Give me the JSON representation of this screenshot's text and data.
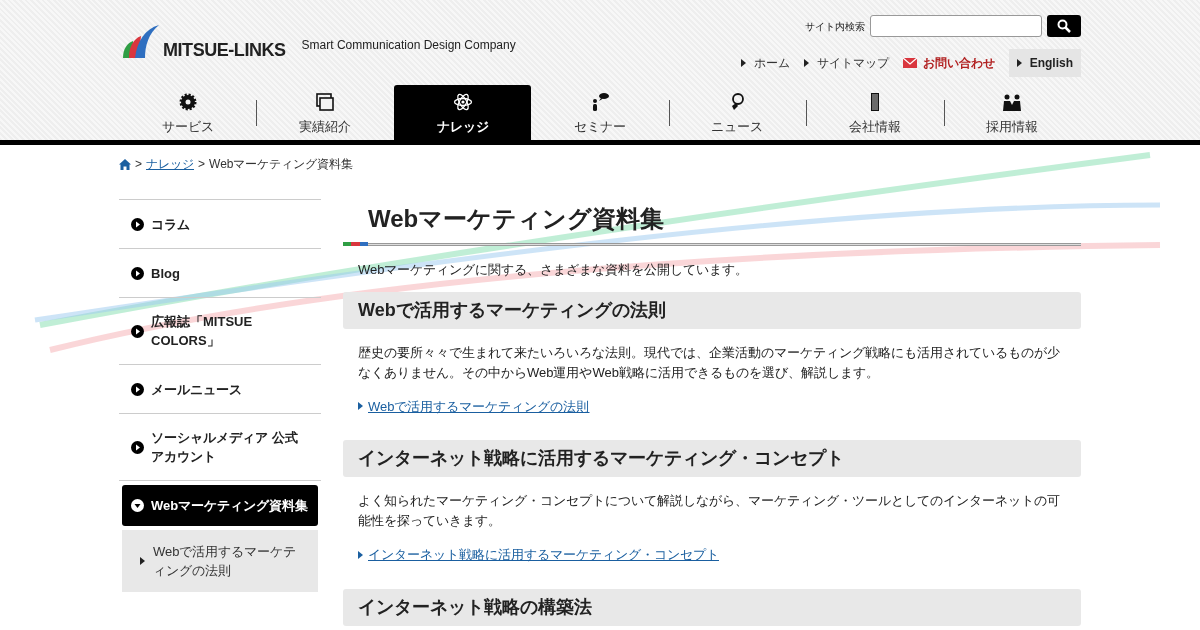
{
  "logo": {
    "text": "MITSUE-LINKS",
    "tagline": "Smart Communication Design Company"
  },
  "search": {
    "label": "サイト内検索"
  },
  "utility_links": [
    {
      "kind": "plain",
      "label": "ホーム"
    },
    {
      "kind": "plain",
      "label": "サイトマップ"
    },
    {
      "kind": "mail",
      "label": "お問い合わせ"
    },
    {
      "kind": "boxed",
      "label": "English"
    }
  ],
  "nav": [
    {
      "label": "サービス",
      "selected": false
    },
    {
      "label": "実績紹介",
      "selected": false
    },
    {
      "label": "ナレッジ",
      "selected": true
    },
    {
      "label": "セミナー",
      "selected": false
    },
    {
      "label": "ニュース",
      "selected": false
    },
    {
      "label": "会社情報",
      "selected": false
    },
    {
      "label": "採用情報",
      "selected": false
    }
  ],
  "breadcrumb": [
    {
      "separator": ">",
      "label": "ナレッジ",
      "link": true
    },
    {
      "separator": ">",
      "label": "Webマーケティング資料集",
      "link": false
    }
  ],
  "sidebar": [
    {
      "kind": "main",
      "label": "コラム"
    },
    {
      "kind": "main",
      "label": "Blog"
    },
    {
      "kind": "main",
      "label": "広報誌「MITSUE COLORS」"
    },
    {
      "kind": "main",
      "label": "メールニュース"
    },
    {
      "kind": "main",
      "label": "ソーシャルメディア 公式アカウント"
    },
    {
      "kind": "active",
      "label": "Webマーケティング資料集"
    },
    {
      "kind": "sub",
      "label": "Webで活用するマーケティングの法則"
    }
  ],
  "page_title": "Webマーケティング資料集",
  "intro": "Webマーケティングに関する、さまざまな資料を公開しています。",
  "sections": [
    {
      "heading": "Webで活用するマーケティングの法則",
      "text": "歴史の要所々々で生まれて来たいろいろな法則。現代では、企業活動のマーケティング戦略にも活用されているものが少なくありません。その中からWeb運用やWeb戦略に活用できるものを選び、解説します。",
      "link": "Webで活用するマーケティングの法則"
    },
    {
      "heading": "インターネット戦略に活用するマーケティング・コンセプト",
      "text": "よく知られたマーケティング・コンセプトについて解説しながら、マーケティング・ツールとしてのインターネットの可能性を探っていきます。",
      "link": "インターネット戦略に活用するマーケティング・コンセプト"
    },
    {
      "heading": "インターネット戦略の構築法"
    }
  ]
}
